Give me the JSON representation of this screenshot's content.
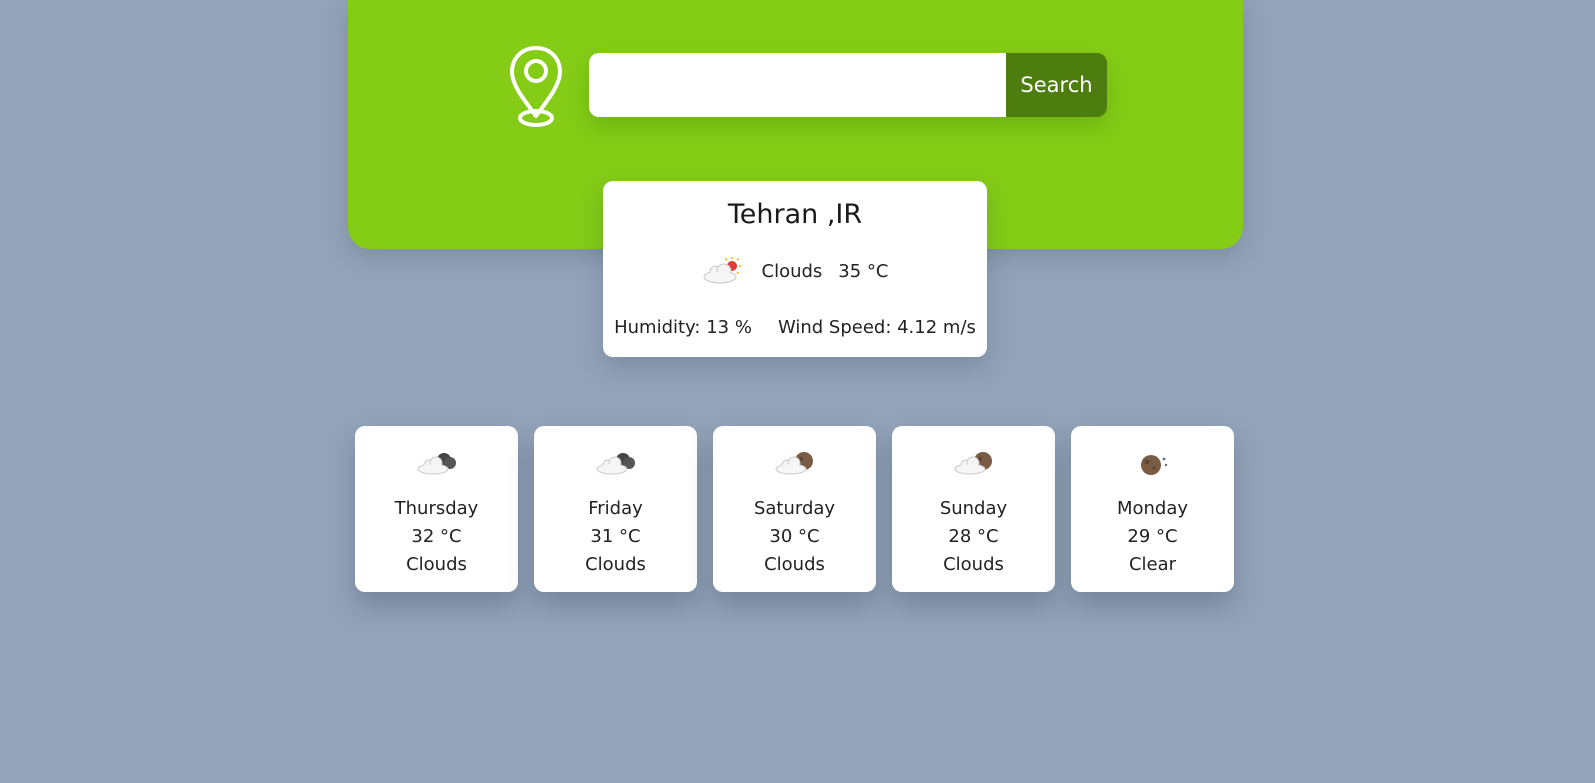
{
  "search": {
    "value": "",
    "placeholder": "",
    "button_label": "Search"
  },
  "current": {
    "city": "Tehran ,IR",
    "condition": "Clouds",
    "temperature": "35 °C",
    "humidity": "Humidity: 13 %",
    "wind": "Wind Speed: 4.12 m/s",
    "icon": "cloud-sun-icon"
  },
  "forecast": [
    {
      "day": "Thursday",
      "temp": "32 °C",
      "condition": "Clouds",
      "icon": "cloud-night-icon"
    },
    {
      "day": "Friday",
      "temp": "31 °C",
      "condition": "Clouds",
      "icon": "cloud-night-icon"
    },
    {
      "day": "Saturday",
      "temp": "30 °C",
      "condition": "Clouds",
      "icon": "cloud-moon-icon"
    },
    {
      "day": "Sunday",
      "temp": "28 °C",
      "condition": "Clouds",
      "icon": "cloud-moon-icon"
    },
    {
      "day": "Monday",
      "temp": "29 °C",
      "condition": "Clear",
      "icon": "moon-icon"
    }
  ],
  "colors": {
    "background": "#93a3b9",
    "hero": "#84cc16",
    "button": "#4d7c0f",
    "card": "#ffffff"
  }
}
